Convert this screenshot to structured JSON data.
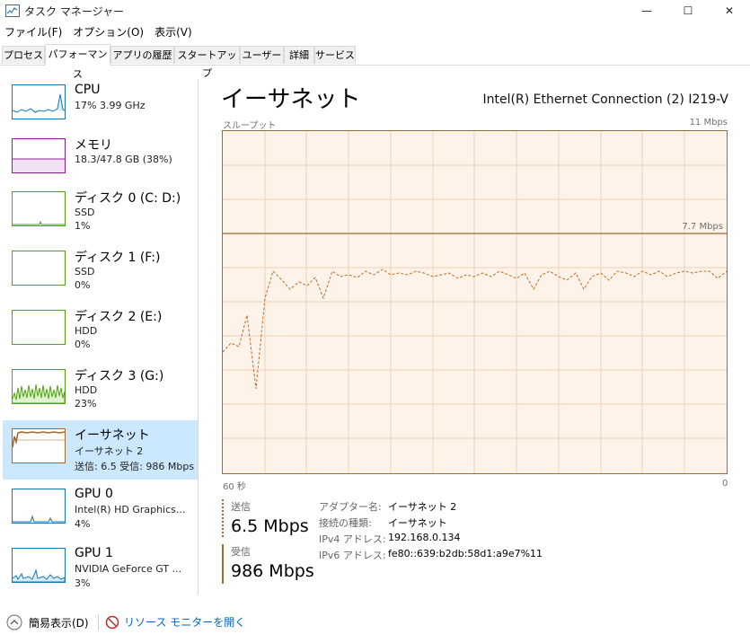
{
  "window": {
    "title": "タスク マネージャー",
    "controls": {
      "minimize": "—",
      "maximize": "☐",
      "close": "✕"
    }
  },
  "menu": [
    "ファイル(F)",
    "オプション(O)",
    "表示(V)"
  ],
  "tabs": [
    {
      "label": "プロセス",
      "active": false
    },
    {
      "label": "パフォーマンス",
      "active": true
    },
    {
      "label": "アプリの履歴",
      "active": false
    },
    {
      "label": "スタートアップ",
      "active": false
    },
    {
      "label": "ユーザー",
      "active": false
    },
    {
      "label": "詳細",
      "active": false
    },
    {
      "label": "サービス",
      "active": false
    }
  ],
  "sidebar": {
    "items": [
      {
        "title": "CPU",
        "line1": "17%  3.99 GHz",
        "line2": "",
        "line3": "",
        "color": "#1779ba",
        "selected": false
      },
      {
        "title": "メモリ",
        "line1": "18.3/47.8 GB (38%)",
        "line2": "",
        "line3": "",
        "color": "#8b1d9b",
        "selected": false
      },
      {
        "title": "ディスク 0 (C: D:)",
        "line1": "SSD",
        "line2": "1%",
        "line3": "",
        "color": "#4da60c",
        "selected": false
      },
      {
        "title": "ディスク 1 (F:)",
        "line1": "SSD",
        "line2": "0%",
        "line3": "",
        "color": "#4da60c",
        "selected": false
      },
      {
        "title": "ディスク 2 (E:)",
        "line1": "HDD",
        "line2": "0%",
        "line3": "",
        "color": "#4da60c",
        "selected": false
      },
      {
        "title": "ディスク 3 (G:)",
        "line1": "HDD",
        "line2": "23%",
        "line3": "",
        "color": "#4da60c",
        "selected": false
      },
      {
        "title": "イーサネット",
        "line1": "イーサネット 2",
        "line2": "送信: 6.5  受信: 986 Mbps",
        "line3": "",
        "color": "#a7672d",
        "selected": true
      },
      {
        "title": "GPU 0",
        "line1": "Intel(R) HD Graphics...",
        "line2": "4%",
        "line3": "",
        "color": "#1779ba",
        "selected": false
      },
      {
        "title": "GPU 1",
        "line1": "NVIDIA GeForce GT ...",
        "line2": "3%",
        "line3": "",
        "color": "#1779ba",
        "selected": false
      }
    ]
  },
  "main": {
    "title": "イーサネット",
    "adapter": "Intel(R) Ethernet Connection (2) I219-V",
    "graph": {
      "ylabel": "スループット",
      "ymax_label": "11 Mbps",
      "scale_line_label": "7.7 Mbps",
      "x_left_label": "60 秒",
      "x_right_label": "0",
      "accent": "#a7672d",
      "fill": "#fdf3e9"
    },
    "send": {
      "label": "送信",
      "value": "6.5 Mbps"
    },
    "receive": {
      "label": "受信",
      "value": "986 Mbps"
    },
    "properties": [
      {
        "key": "アダプター名:",
        "value": "イーサネット 2"
      },
      {
        "key": "接続の種類:",
        "value": "イーサネット"
      },
      {
        "key": "IPv4 アドレス:",
        "value": "192.168.0.134"
      },
      {
        "key": "IPv6 アドレス:",
        "value": "fe80::639:b2db:58d1:a9e7%11"
      }
    ]
  },
  "footer": {
    "summary": "簡易表示(D)",
    "resource_monitor": "リソース モニターを開く"
  }
}
